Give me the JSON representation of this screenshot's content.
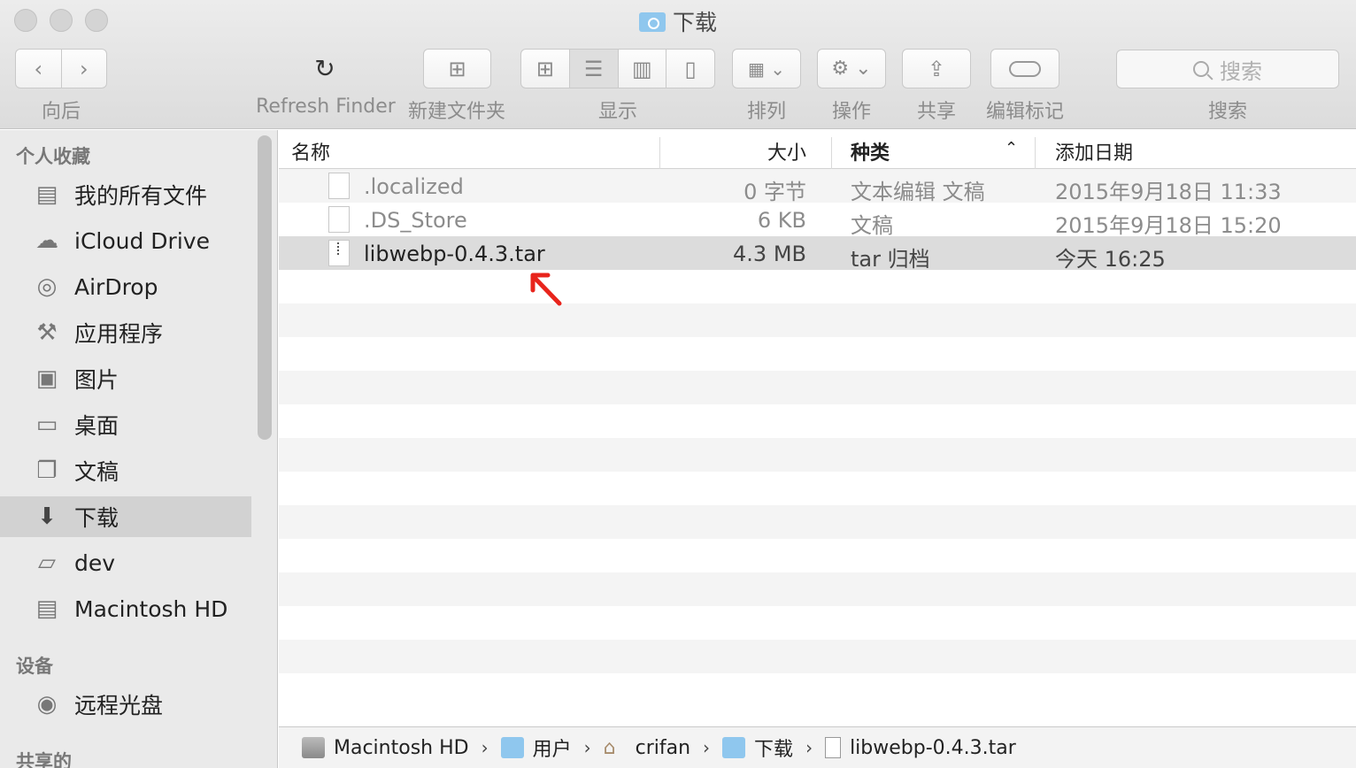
{
  "window": {
    "title": "下载"
  },
  "toolbar": {
    "back_label": "向后",
    "refresh_label": "Refresh Finder",
    "new_folder_label": "新建文件夹",
    "view_label": "显示",
    "arrange_label": "排列",
    "action_label": "操作",
    "share_label": "共享",
    "tags_label": "编辑标记",
    "search_label": "搜索",
    "search_placeholder": "搜索"
  },
  "sidebar": {
    "favorites_title": "个人收藏",
    "favorites": [
      {
        "label": "我的所有文件",
        "icon": "all-files-icon"
      },
      {
        "label": "iCloud Drive",
        "icon": "cloud-icon"
      },
      {
        "label": "AirDrop",
        "icon": "airdrop-icon"
      },
      {
        "label": "应用程序",
        "icon": "applications-icon"
      },
      {
        "label": "图片",
        "icon": "camera-icon"
      },
      {
        "label": "桌面",
        "icon": "desktop-icon"
      },
      {
        "label": "文稿",
        "icon": "documents-icon"
      },
      {
        "label": "下载",
        "icon": "download-icon",
        "selected": true
      },
      {
        "label": "dev",
        "icon": "folder-icon"
      },
      {
        "label": "Macintosh HD",
        "icon": "hard-drive-icon"
      }
    ],
    "devices_title": "设备",
    "devices": [
      {
        "label": "远程光盘",
        "icon": "disc-icon"
      }
    ],
    "shared_title": "共享的"
  },
  "columns": {
    "name": "名称",
    "size": "大小",
    "kind": "种类",
    "date": "添加日期"
  },
  "files": [
    {
      "name": ".localized",
      "size": "0 字节",
      "kind": "文本编辑 文稿",
      "date": "2015年9月18日 11:33"
    },
    {
      "name": ".DS_Store",
      "size": "6 KB",
      "kind": "文稿",
      "date": "2015年9月18日 15:20"
    },
    {
      "name": "libwebp-0.4.3.tar",
      "size": "4.3 MB",
      "kind": "tar 归档",
      "date": "今天 16:25"
    }
  ],
  "pathbar": [
    "Macintosh HD",
    "用户",
    "crifan",
    "下载",
    "libwebp-0.4.3.tar"
  ],
  "colors": {
    "selected_row": "#dcdcdc",
    "sidebar_bg": "#eaeaea",
    "annotation_arrow": "#e8241c"
  }
}
